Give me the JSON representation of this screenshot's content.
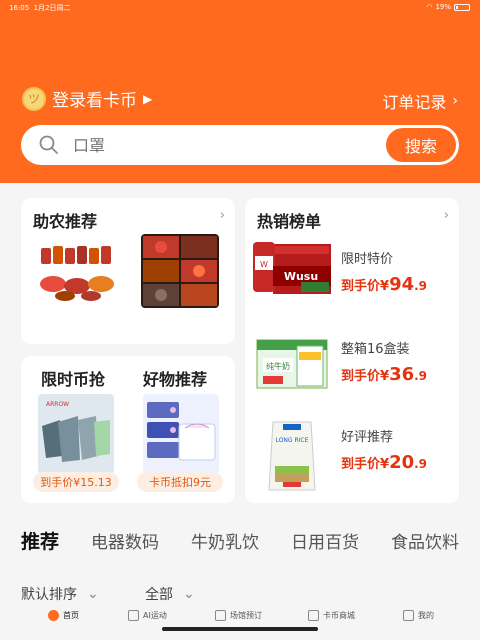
{
  "status_bar": {
    "time": "16:05",
    "date": "1月2日周二",
    "battery": "19%"
  },
  "header": {
    "login_label": "登录看卡币",
    "orders_label": "订单记录",
    "search": {
      "placeholder": "口罩",
      "button": "搜索"
    }
  },
  "cards": {
    "zhunong": {
      "title": "助农推荐"
    },
    "hot": {
      "title": "热销榜单",
      "items": [
        {
          "label": "限时特价",
          "price_prefix": "到手价",
          "currency": "¥",
          "price_int": "94",
          "price_dec": ".9",
          "image": "beer-case"
        },
        {
          "label": "整箱16盒装",
          "price_prefix": "到手价",
          "currency": "¥",
          "price_int": "36",
          "price_dec": ".9",
          "image": "milk-box"
        },
        {
          "label": "好评推荐",
          "price_prefix": "到手价",
          "currency": "¥",
          "price_int": "20",
          "price_dec": ".9",
          "image": "rice-bag"
        }
      ]
    },
    "flash": {
      "title": "限时币抢",
      "price": "到手价¥15.13"
    },
    "goods": {
      "title": "好物推荐",
      "price": "卡币抵扣9元"
    }
  },
  "tabs": [
    "推荐",
    "电器数码",
    "牛奶乳饮",
    "日用百货",
    "食品饮料"
  ],
  "filters": {
    "sort": "默认排序",
    "category": "全部"
  },
  "bottom_nav": [
    "首页",
    "AI运动",
    "场馆预订",
    "卡币商城",
    "我的"
  ],
  "colors": {
    "brand": "#ff6a1f",
    "price": "#e5330f"
  }
}
